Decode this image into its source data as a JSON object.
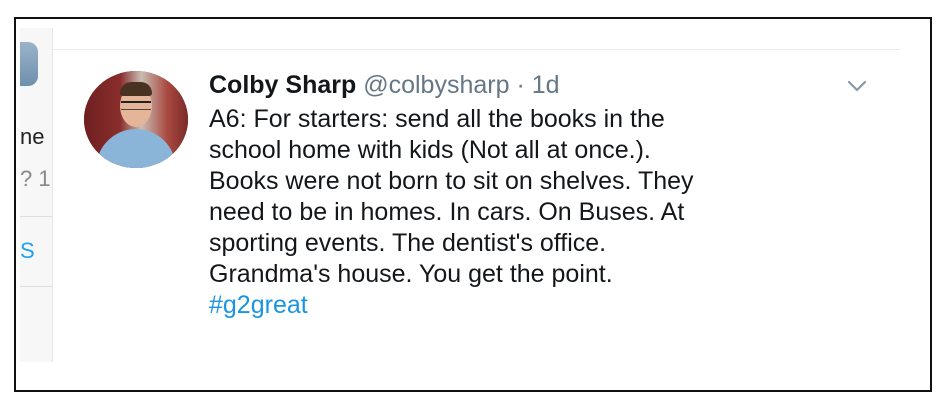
{
  "tweet": {
    "author_name": "Colby Sharp",
    "handle": "@colbysharp",
    "separator": "·",
    "time": "1d",
    "lines": [
      "A6: For starters: send all the books in the",
      "school home with kids (Not all at once.).",
      "Books were not born to sit on shelves. They",
      "need to be in homes. In cars. On Buses. At",
      "sporting events. The dentist's office.",
      "Grandma's house. You get the point."
    ],
    "hashtag": "#g2great"
  },
  "previous_tweet_fragment": {
    "name_fragment": "ne",
    "meta_fragment": "? 1",
    "link_fragment": "S"
  },
  "icons": {
    "avatar": "profile-photo",
    "menu": "chevron-down-icon"
  },
  "colors": {
    "link": "#1b95e0",
    "muted": "#657786",
    "text": "#14171a"
  }
}
